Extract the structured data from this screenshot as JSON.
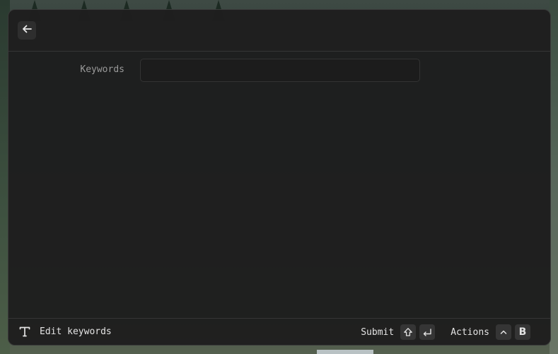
{
  "window": {
    "back_icon": "arrow-left-icon"
  },
  "form": {
    "keywords_label": "Keywords",
    "keywords_value": "",
    "keywords_placeholder": ""
  },
  "footer": {
    "primary_icon": "text-t-icon",
    "primary_label": "Edit keywords",
    "submit_label": "Submit",
    "submit_keys": [
      "shift-icon",
      "enter-icon"
    ],
    "actions_label": "Actions",
    "actions_keys": [
      "ctrl-caret-icon",
      "B"
    ]
  },
  "colors": {
    "window_bg": "#1e1e1e",
    "divider": "#363636",
    "label_text": "#9a9a9a",
    "primary_text": "#e4e4e4",
    "key_bg": "#353535"
  }
}
